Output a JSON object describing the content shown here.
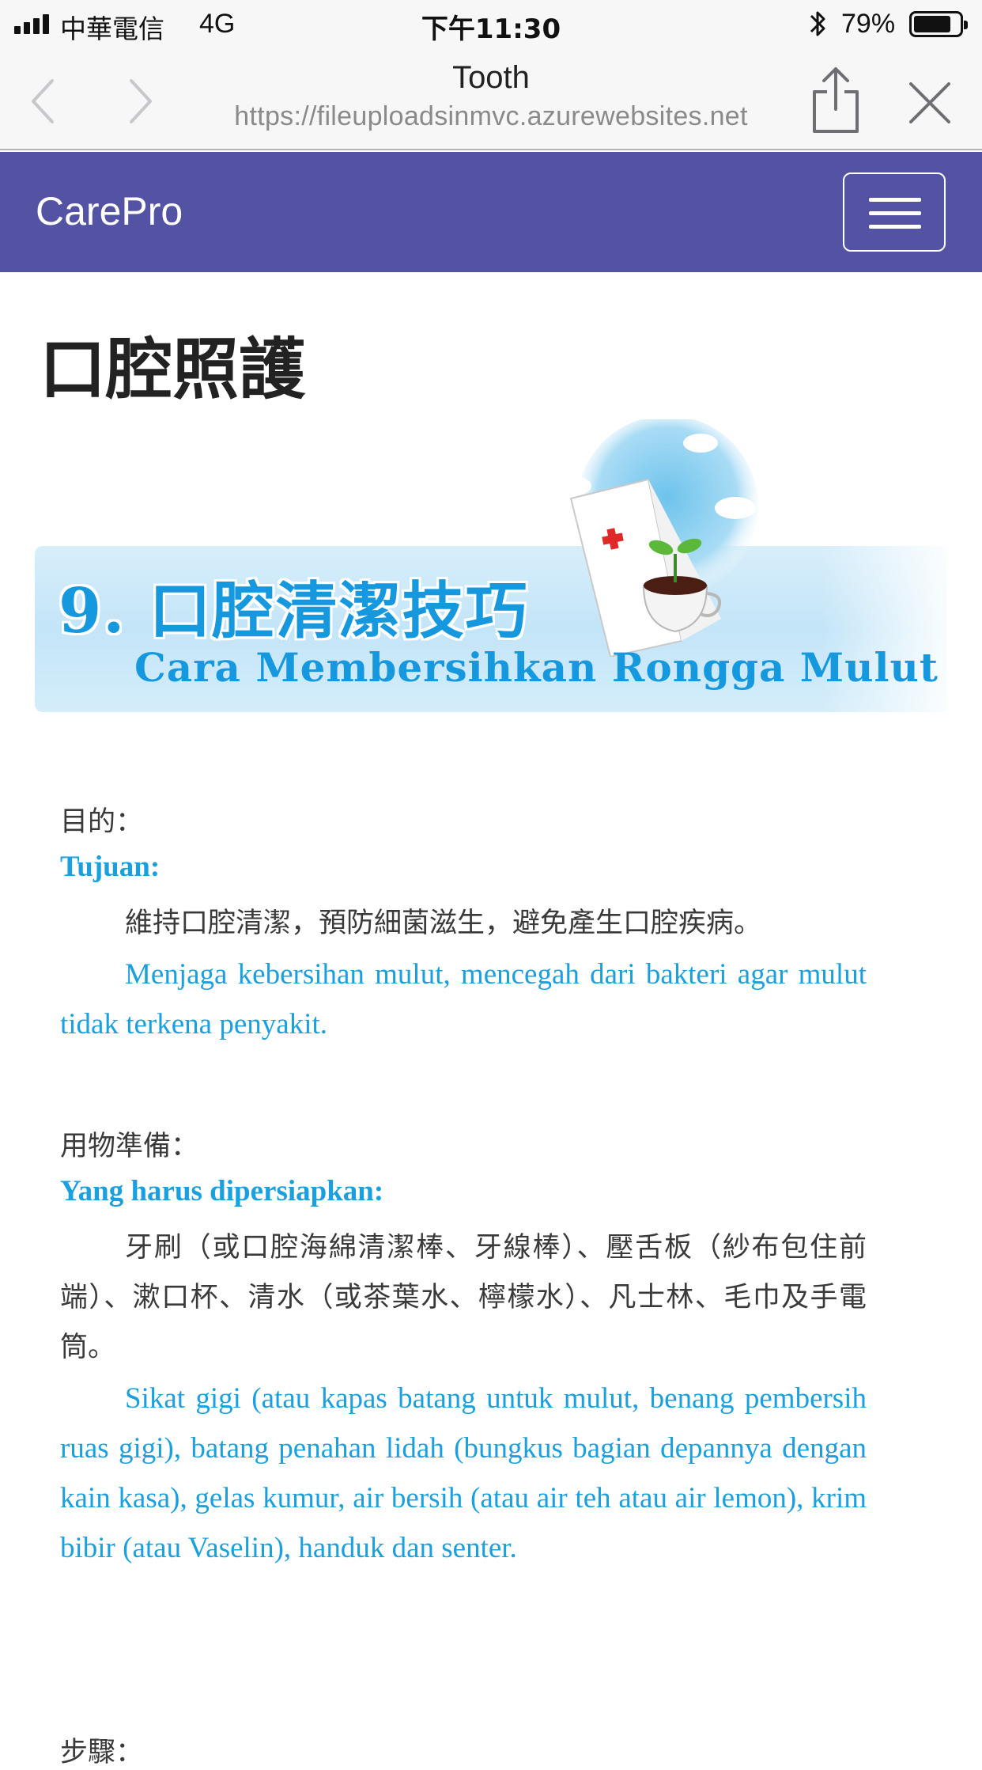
{
  "status_bar": {
    "carrier": "中華電信",
    "network": "4G",
    "time": "下午11:30",
    "battery_percent": "79%",
    "battery_level": 0.79
  },
  "browser": {
    "page_title": "Tooth",
    "url": "https://fileuploadsinmvc.azurewebsites.net",
    "icons": {
      "back": "chevron-left-icon",
      "forward": "chevron-right-icon",
      "share": "share-icon",
      "close": "close-icon"
    }
  },
  "navbar": {
    "brand": "CarePro",
    "menu_icon": "hamburger-icon",
    "color": "#5352a3"
  },
  "page": {
    "heading": "口腔照護",
    "banner": {
      "title": "9. 口腔清潔技巧",
      "subtitle": "Cara Membersihkan Rongga Mulut"
    },
    "sections": [
      {
        "label_zh": "目的：",
        "label_id": "Tujuan:",
        "text_zh": "維持口腔清潔，預防細菌滋生，避免產生口腔疾病。",
        "text_id": "Menjaga kebersihan mulut, mencegah dari bakteri agar mulut tidak terkena penyakit."
      },
      {
        "label_zh": "用物準備：",
        "label_id": "Yang harus dipersiapkan:",
        "text_zh": "牙刷（或口腔海綿清潔棒、牙線棒）、壓舌板（紗布包住前端）、漱口杯、清水（或茶葉水、檸檬水）、凡士林、毛巾及手電筒。",
        "text_id": "Sikat gigi (atau kapas batang untuk mulut, benang pembersih ruas gigi), batang penahan lidah (bungkus bagian depannya dengan kain kasa), gelas kumur, air bersih (atau air teh atau air lemon), krim bibir (atau Vaselin), handuk dan senter."
      }
    ],
    "next_label": "步驟："
  },
  "colors": {
    "chinese_text": "#3a3a3a",
    "indonesian_text": "#1aa0de",
    "banner_text": "#1598dd"
  }
}
